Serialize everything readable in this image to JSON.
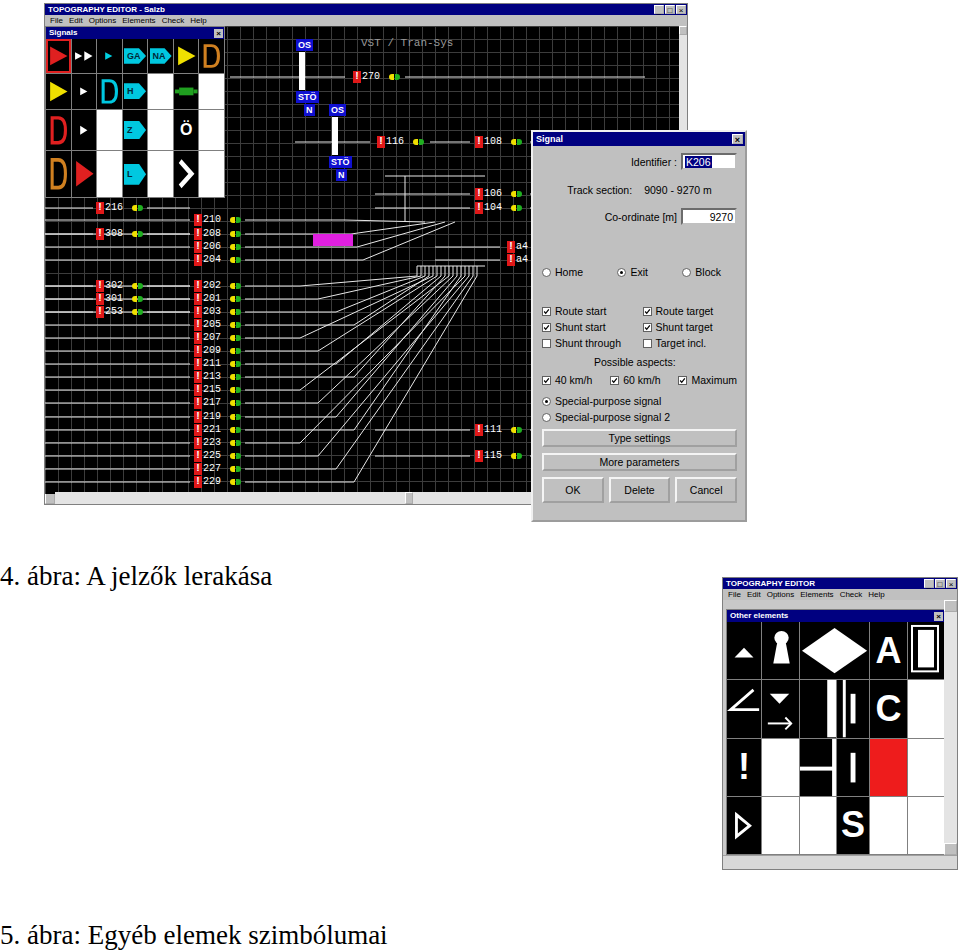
{
  "figure1": {
    "window": {
      "title": "TOPOGRAPHY EDITOR - Salzb",
      "controls": [
        "_",
        "□",
        "×"
      ]
    },
    "menu": [
      "File",
      "Edit",
      "Options",
      "Elements",
      "Check",
      "Help"
    ],
    "palette": {
      "title": "Signals",
      "close": "×",
      "cells": [
        {
          "kind": "arrow",
          "color": "#e02020",
          "selected": true
        },
        {
          "kind": "dbl-arrow",
          "color": "#ffffff",
          "selected": false
        },
        {
          "kind": "arrow-small",
          "color": "#00d0e0",
          "selected": false
        },
        {
          "kind": "pentagon",
          "color": "#00c8e0",
          "text": "GA",
          "selected": false
        },
        {
          "kind": "pentagon",
          "color": "#00c8e0",
          "text": "NA",
          "selected": false
        },
        {
          "kind": "arrow",
          "color": "#f0e000",
          "selected": false
        },
        {
          "kind": "d-shape",
          "color": "#d08020",
          "selected": false
        },
        {
          "kind": "arrow",
          "color": "#f0e000",
          "selected": false
        },
        {
          "kind": "arrow-small",
          "color": "#ffffff",
          "selected": false
        },
        {
          "kind": "d-shape",
          "color": "#00c8e0",
          "selected": false
        },
        {
          "kind": "pentagon",
          "color": "#00c8e0",
          "text": "H",
          "selected": false
        },
        {
          "kind": "blank",
          "color": "#ffffff",
          "selected": false
        },
        {
          "kind": "plug",
          "color": "#20a020",
          "selected": false
        },
        {
          "kind": "blank",
          "color": "#ffffff",
          "selected": false
        },
        {
          "kind": "d-shape",
          "color": "#e02020",
          "selected": false
        },
        {
          "kind": "arrow-small",
          "color": "#ffffff",
          "selected": false
        },
        {
          "kind": "blank",
          "color": "#ffffff",
          "selected": false
        },
        {
          "kind": "pentagon",
          "color": "#00c8e0",
          "text": "Z",
          "selected": false
        },
        {
          "kind": "blank",
          "color": "#ffffff",
          "selected": false
        },
        {
          "kind": "letter",
          "color": "#ffffff",
          "text": "Ö",
          "selected": false
        },
        {
          "kind": "blank",
          "color": "#ffffff",
          "selected": false
        },
        {
          "kind": "d-shape",
          "color": "#d08020",
          "selected": false
        },
        {
          "kind": "arrow",
          "color": "#e02020",
          "selected": false
        },
        {
          "kind": "blank",
          "color": "#ffffff",
          "selected": false
        },
        {
          "kind": "pentagon",
          "color": "#00c8e0",
          "text": "L",
          "selected": false
        },
        {
          "kind": "blank",
          "color": "#ffffff",
          "selected": false
        },
        {
          "kind": "chevron",
          "color": "#ffffff",
          "selected": false
        },
        {
          "kind": "blank",
          "color": "#ffffff",
          "selected": false
        }
      ]
    },
    "canvas": {
      "heading": "VST / Tran-Sys",
      "marker": "!",
      "blocks": [
        {
          "text": "OS"
        },
        {
          "text": "STÖ"
        },
        {
          "text": "N"
        },
        {
          "text": "OS"
        },
        {
          "text": "STÖ"
        },
        {
          "text": "N"
        }
      ],
      "signals": [
        {
          "number": "270",
          "selected": false
        },
        {
          "number": "116",
          "selected": false
        },
        {
          "number": "108",
          "selected": false
        },
        {
          "number": "106",
          "selected": false
        },
        {
          "number": "104",
          "selected": false
        },
        {
          "number": "216",
          "selected": false
        },
        {
          "number": "308",
          "selected": false
        },
        {
          "number": "210",
          "selected": false
        },
        {
          "number": "208",
          "selected": false
        },
        {
          "number": "206",
          "selected": true
        },
        {
          "number": "204",
          "selected": false
        },
        {
          "number": "302",
          "selected": false
        },
        {
          "number": "301",
          "selected": false
        },
        {
          "number": "253",
          "selected": false
        },
        {
          "number": "202",
          "selected": false
        },
        {
          "number": "201",
          "selected": false
        },
        {
          "number": "203",
          "selected": false
        },
        {
          "number": "205",
          "selected": false
        },
        {
          "number": "207",
          "selected": false
        },
        {
          "number": "209",
          "selected": false
        },
        {
          "number": "211",
          "selected": false
        },
        {
          "number": "213",
          "selected": false
        },
        {
          "number": "215",
          "selected": false
        },
        {
          "number": "217",
          "selected": false
        },
        {
          "number": "219",
          "selected": false
        },
        {
          "number": "221",
          "selected": false
        },
        {
          "number": "223",
          "selected": false
        },
        {
          "number": "225",
          "selected": false
        },
        {
          "number": "227",
          "selected": false
        },
        {
          "number": "229",
          "selected": false
        },
        {
          "number": "111",
          "selected": false
        },
        {
          "number": "115",
          "selected": false
        },
        {
          "number": "a4",
          "selected": false
        },
        {
          "number": "a4",
          "selected": false
        }
      ]
    },
    "dialog": {
      "title": "Signal",
      "close": "×",
      "identifier": {
        "label": "Identifier :",
        "value": "K206",
        "highlighted": true
      },
      "track_section": {
        "label": "Track section:",
        "value": "9090 - 9270 m"
      },
      "coordinate": {
        "label": "Co-ordinate [m]",
        "value": "9270"
      },
      "position": [
        {
          "label": "Home",
          "selected": false
        },
        {
          "label": "Exit",
          "selected": true
        },
        {
          "label": "Block",
          "selected": false
        }
      ],
      "options": [
        {
          "label": "Route start",
          "checked": true
        },
        {
          "label": "Route target",
          "checked": true
        },
        {
          "label": "Shunt start",
          "checked": true
        },
        {
          "label": "Shunt target",
          "checked": true
        },
        {
          "label": "Shunt through",
          "checked": false
        },
        {
          "label": "Target incl.",
          "checked": false
        }
      ],
      "aspects_title": "Possible aspects:",
      "aspects": [
        {
          "label": "40 km/h",
          "checked": true
        },
        {
          "label": "60 km/h",
          "checked": true
        },
        {
          "label": "Maximum",
          "checked": true
        }
      ],
      "special": [
        {
          "label": "Special-purpose signal",
          "selected": true
        },
        {
          "label": "Special-purpose signal 2",
          "selected": false
        }
      ],
      "wide_buttons": [
        "Type settings",
        "More parameters"
      ],
      "buttons": [
        "OK",
        "Delete",
        "Cancel"
      ]
    },
    "caption": "4. ábra: A jelzők lerakása"
  },
  "figure2": {
    "window": {
      "title": "TOPOGRAPHY EDITOR",
      "controls": [
        "_",
        "□",
        "×"
      ]
    },
    "menu": [
      "File",
      "Edit",
      "Options",
      "Elements",
      "Check",
      "Help"
    ],
    "palette": {
      "title": "Other elements",
      "close": "×",
      "cells": [
        {
          "kind": "triangle-up"
        },
        {
          "kind": "keyhole"
        },
        {
          "kind": "diamond"
        },
        {
          "kind": "letter",
          "text": "A"
        },
        {
          "kind": "box-outline"
        },
        {
          "kind": "angle"
        },
        {
          "kind": "arrow-down-right"
        },
        {
          "kind": "bar-v"
        },
        {
          "kind": "double-bar"
        },
        {
          "kind": "letter",
          "text": "C"
        },
        {
          "kind": "blank"
        },
        {
          "kind": "letter",
          "text": "!"
        },
        {
          "kind": "blank"
        },
        {
          "kind": "bar-h"
        },
        {
          "kind": "bar-v-thin"
        },
        {
          "kind": "red-box"
        },
        {
          "kind": "blank"
        },
        {
          "kind": "triangle-outline"
        },
        {
          "kind": "blank"
        },
        {
          "kind": "blank"
        },
        {
          "kind": "letter",
          "text": "S"
        },
        {
          "kind": "blank"
        },
        {
          "kind": "blank"
        }
      ]
    },
    "caption": "5. ábra: Egyéb elemek szimbólumai"
  }
}
